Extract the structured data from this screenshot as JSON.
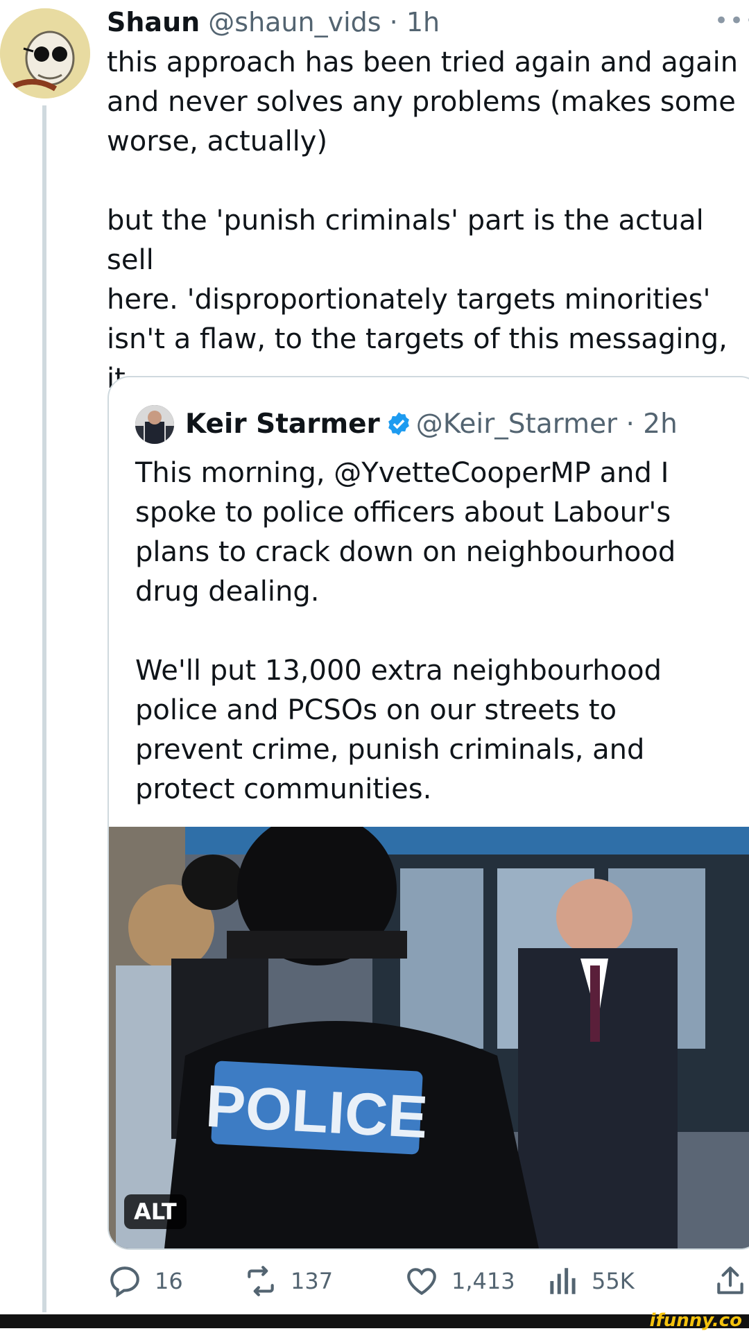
{
  "author": {
    "name": "Shaun",
    "handle": "@shaun_vids",
    "time": "· 1h"
  },
  "tweet": {
    "text": "this approach has been tried again and again\nand never solves any problems (makes some\nworse, actually)\n\nbut the 'punish criminals' part is the actual sell\nhere. 'disproportionately targets minorities'\nisn't a flaw, to the targets of this messaging, it\nis the whole point"
  },
  "more_icon": "ellipsis-icon",
  "quote": {
    "name": "Keir Starmer",
    "handle": "@Keir_Starmer",
    "time": "· 2h",
    "verified_icon": "verified-badge-icon",
    "text": "This morning, @YvetteCooperMP and I\nspoke to police officers about Labour's\nplans to crack down on neighbourhood\ndrug dealing.\n\nWe'll put 13,000 extra neighbourhood\npolice and PCSOs on our streets to\nprevent crime, punish criminals, and\nprotect communities.",
    "photo": {
      "alt_label": "ALT",
      "sign_text": "POLICE"
    }
  },
  "actions": {
    "replies": "16",
    "retweets": "137",
    "likes": "1,413",
    "views": "55K"
  },
  "colors": {
    "verified": "#1d9bf0",
    "muted_text": "#536471",
    "border": "#cfd9de",
    "watermark": "#f4c20d"
  },
  "watermark": "ifunny.co"
}
